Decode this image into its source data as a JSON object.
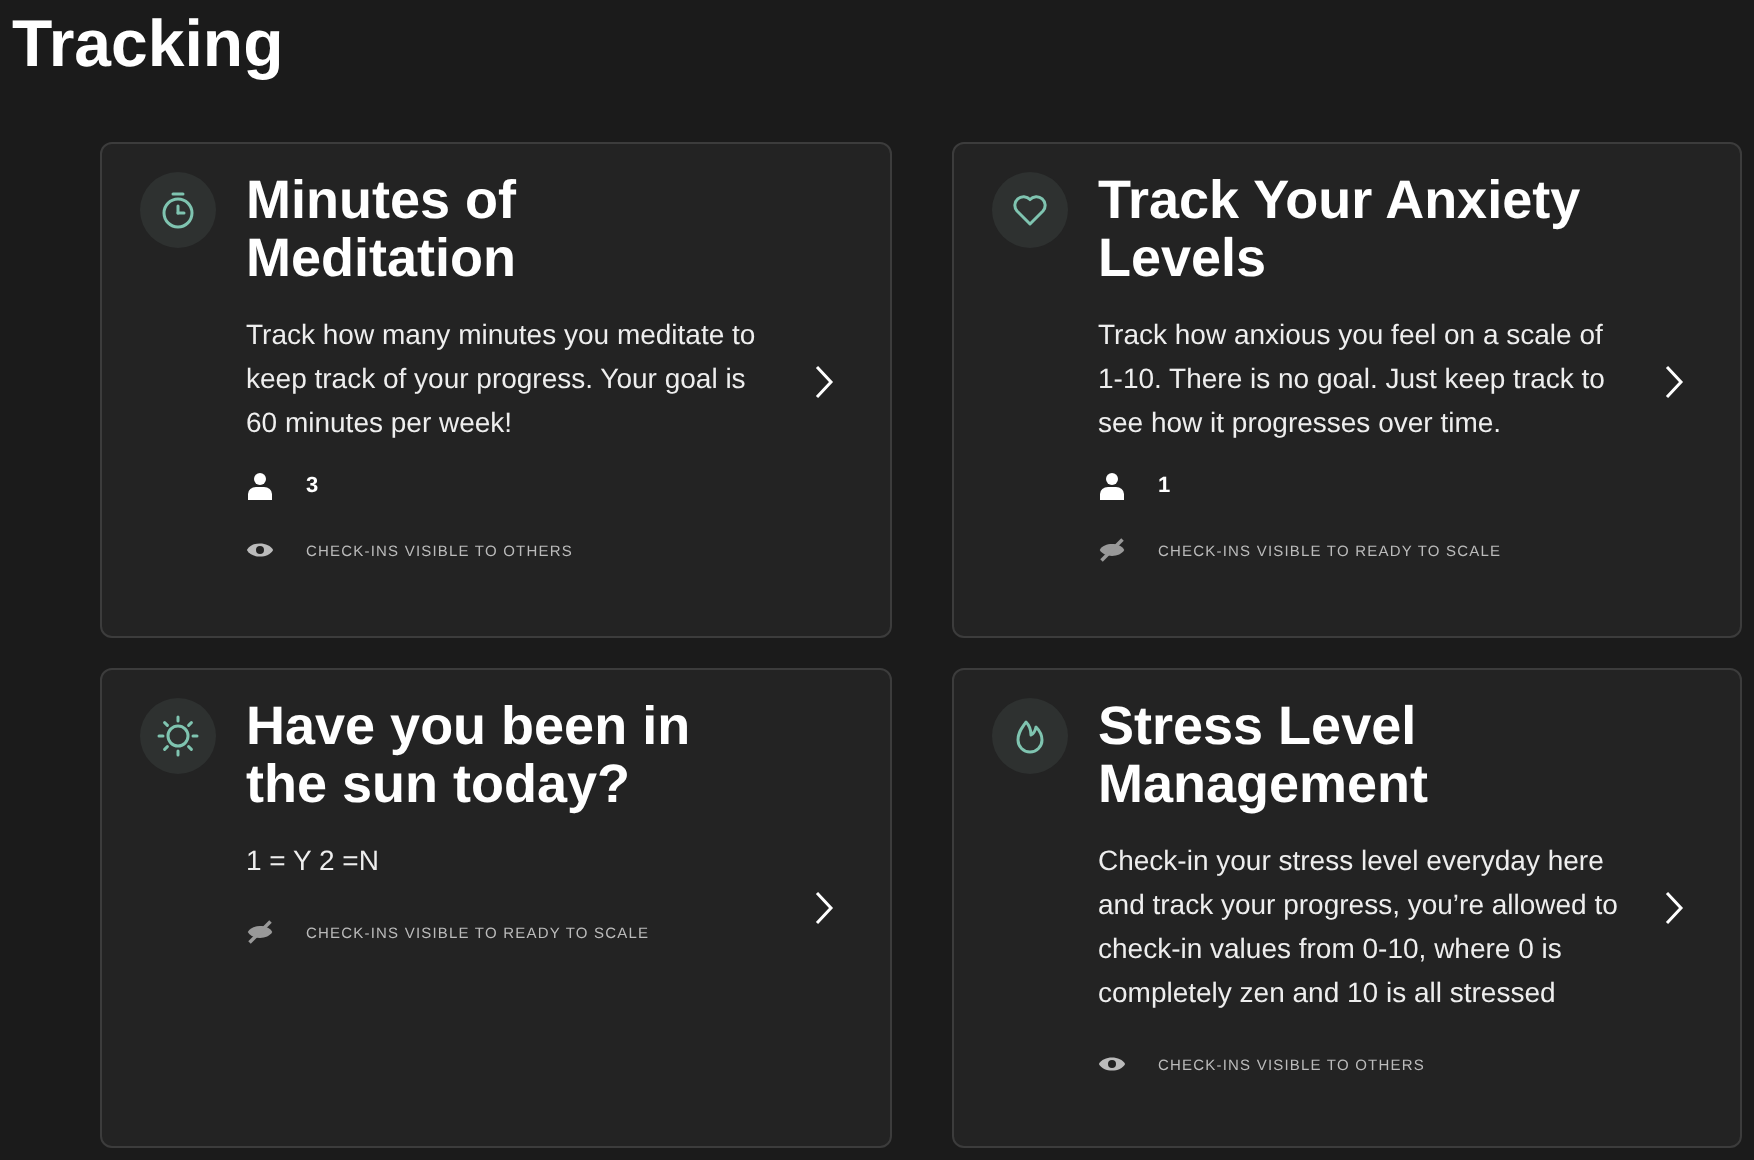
{
  "page_title": "Tracking",
  "cards": [
    {
      "kind": "timer",
      "title": "Minutes of Meditation",
      "description": "Track how many minutes you meditate to keep track of your progress. Your goal is 60 minutes per week!",
      "participants": "3",
      "hidden": false,
      "visibility_label": "CHECK-INS VISIBLE TO OTHERS"
    },
    {
      "kind": "heart",
      "title": "Track Your Anxiety Levels",
      "description": "Track how anxious you feel on a scale of 1-10. There is no goal. Just keep track to see how it progresses over time.",
      "participants": "1",
      "hidden": true,
      "visibility_label": "CHECK-INS VISIBLE TO READY TO SCALE"
    },
    {
      "kind": "sun",
      "title": "Have you been in the sun today?",
      "description": "1 = Y 2 =N",
      "hidden": true,
      "visibility_label": "CHECK-INS VISIBLE TO READY TO SCALE"
    },
    {
      "kind": "flame",
      "title": "Stress Level Management",
      "description": "Check-in your stress level everyday here and track your progress, you’re allowed to check-in values from 0-10, where 0 is completely zen and 10 is all stressed",
      "hidden": false,
      "visibility_label": "CHECK-INS VISIBLE TO OTHERS"
    }
  ]
}
